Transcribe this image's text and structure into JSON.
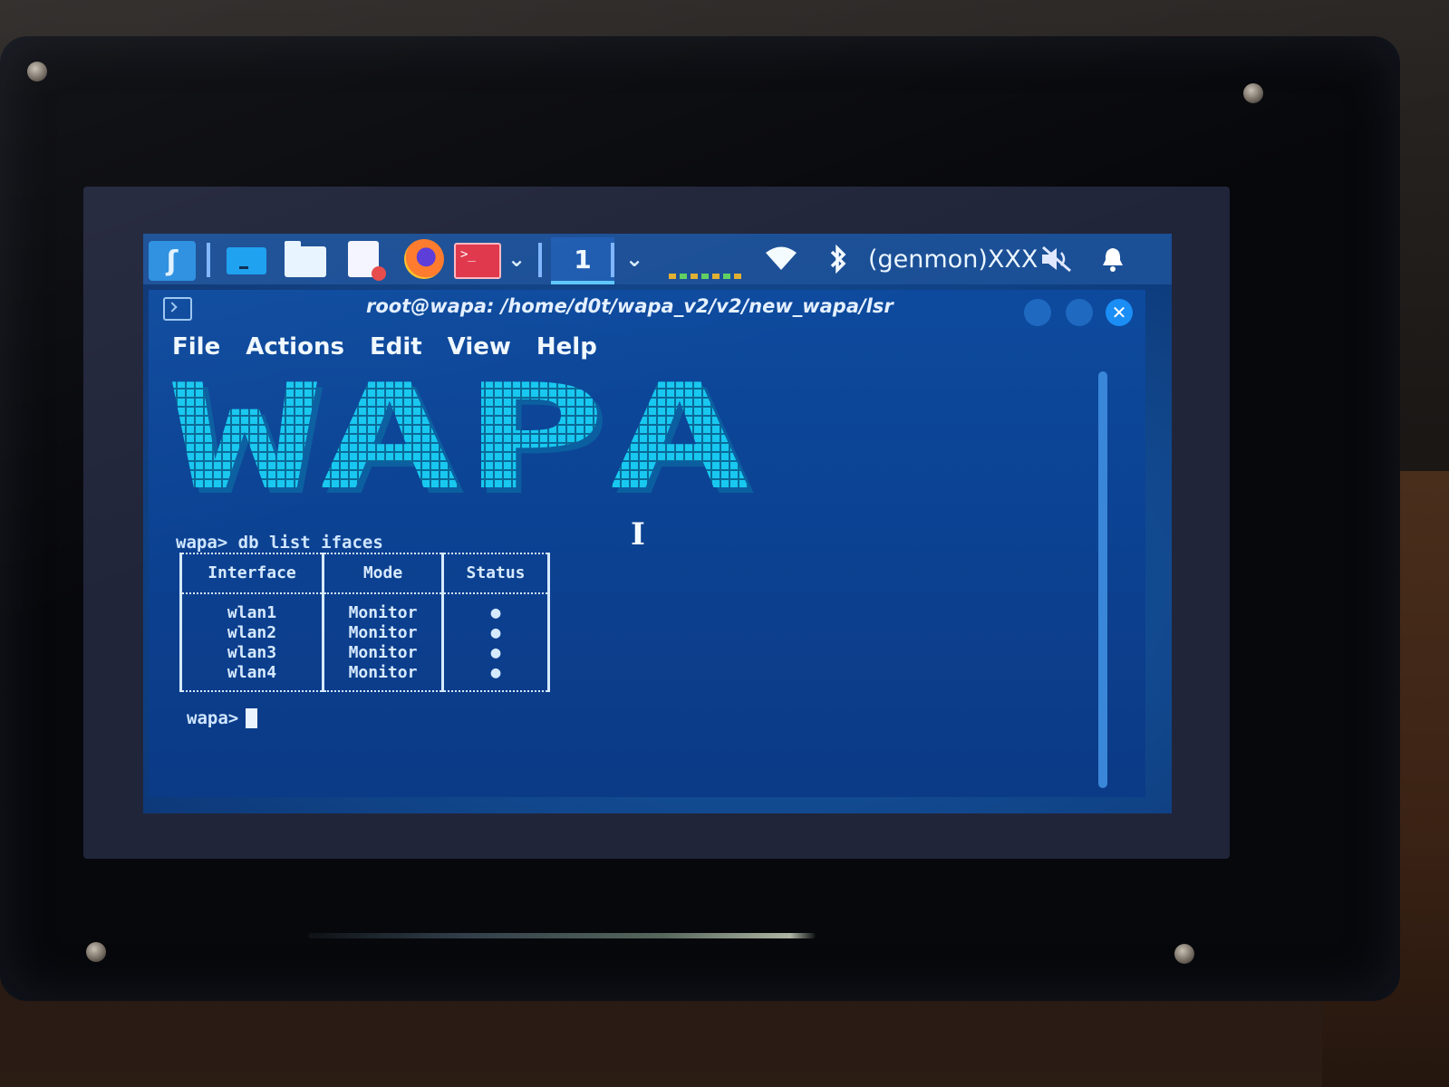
{
  "panel": {
    "launcher_icon": "kali-dragon-icon",
    "apps": [
      "terminal-icon",
      "file-manager-icon",
      "text-editor-icon",
      "firefox-icon",
      "root-terminal-icon"
    ],
    "workspace": "1",
    "chevron": "⌄",
    "genmon_label": "(genmon)XXX",
    "status_icons": [
      "wifi-icon",
      "bluetooth-icon",
      "volume-muted-icon",
      "notification-bell-icon"
    ]
  },
  "window": {
    "title": "root@wapa: /home/d0t/wapa_v2/v2/new_wapa/lsr",
    "menu": [
      "File",
      "Actions",
      "Edit",
      "View",
      "Help"
    ]
  },
  "terminal": {
    "banner": "WAPA",
    "command_prompt": "wapa> db list ifaces",
    "table": {
      "headers": [
        "Interface",
        "Mode",
        "Status"
      ],
      "rows": [
        {
          "interface": "wlan1",
          "mode": "Monitor",
          "status": "●"
        },
        {
          "interface": "wlan2",
          "mode": "Monitor",
          "status": "●"
        },
        {
          "interface": "wlan3",
          "mode": "Monitor",
          "status": "●"
        },
        {
          "interface": "wlan4",
          "mode": "Monitor",
          "status": "●"
        }
      ]
    },
    "prompt": "wapa>"
  },
  "colors": {
    "accent": "#5ec8ff",
    "banner_fill": "#18c8f0",
    "terminal_bg": "#0c4394",
    "panel_bg": "#1b4f96"
  }
}
